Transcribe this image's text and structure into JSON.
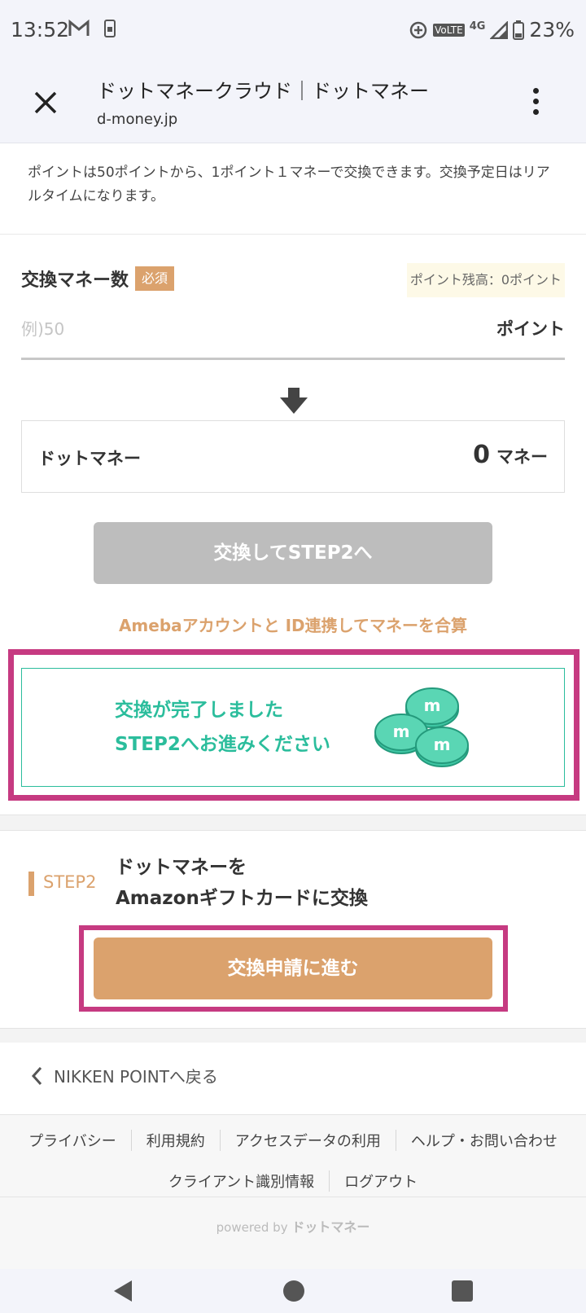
{
  "status_bar": {
    "time": "13:52",
    "network_label": "VoLTE",
    "network_type": "4G",
    "battery": "23%",
    "icons": [
      "gmail-icon",
      "sim-card-icon",
      "data-saver-icon",
      "signal-icon",
      "battery-icon"
    ]
  },
  "toolbar": {
    "title": "ドットマネークラウド｜ドットマネー",
    "url": "d-money.jp"
  },
  "notice": {
    "text": "ポイントは50ポイントから、1ポイント１マネーで交換できます。交換予定日はリアルタイムになります。"
  },
  "exchange": {
    "label": "交換マネー数",
    "required_badge": "必須",
    "balance": "ポイント残高：0ポイント",
    "input_placeholder": "例)50",
    "input_unit": "ポイント",
    "money_label": "ドットマネー",
    "money_value": "0",
    "money_unit": "マネー",
    "exchange_button": "交換してSTEP2へ",
    "ameba_link": "Amebaアカウントと ID連携してマネーを合算"
  },
  "complete": {
    "line1": "交換が完了しました",
    "line2": "STEP2へお進みください"
  },
  "step2": {
    "label": "STEP2",
    "title_line1": "ドットマネーを",
    "title_line2": "Amazonギフトカードに交換",
    "button": "交換申請に進む"
  },
  "back_link": "NIKKEN POINTへ戻る",
  "footer": {
    "links_row1": [
      "プライバシー",
      "利用規約",
      "アクセスデータの利用",
      "ヘルプ・お問い合わせ"
    ],
    "links_row2": [
      "クライアント識別情報",
      "ログアウト"
    ],
    "powered_by": "powered by",
    "powered_brand": "ドットマネー"
  },
  "colors": {
    "accent": "#dba26d",
    "success": "#2bbd9c",
    "highlight": "#c63a81",
    "disabled": "#bdbdbd"
  }
}
